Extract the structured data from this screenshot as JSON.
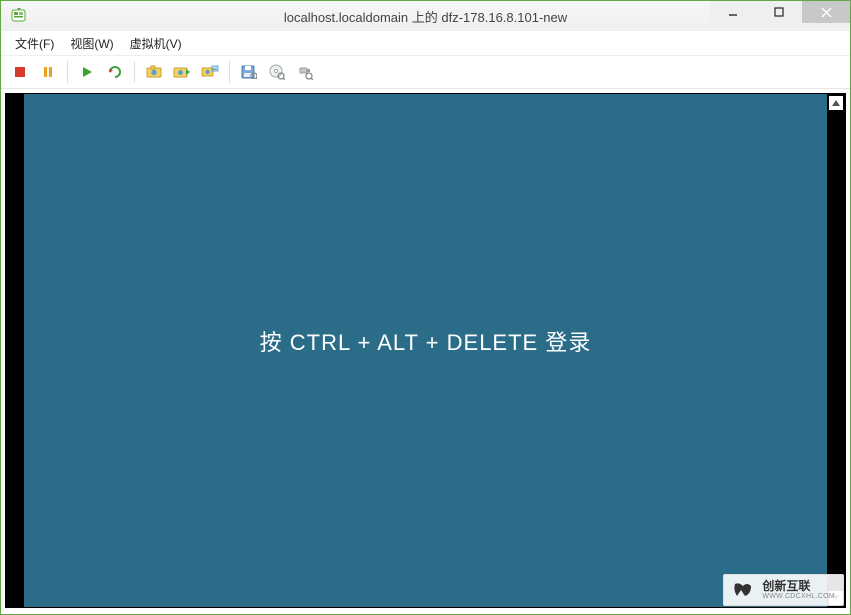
{
  "titlebar": {
    "title": "localhost.localdomain 上的 dfz-178.16.8.101-new"
  },
  "menu": {
    "file": "文件(F)",
    "view": "视图(W)",
    "vm": "虚拟机(V)"
  },
  "vm_screen": {
    "login_prompt": "按 CTRL + ALT + DELETE 登录"
  },
  "watermark": {
    "name": "创新互联",
    "sub": "WWW.CDCXHL.COM"
  }
}
